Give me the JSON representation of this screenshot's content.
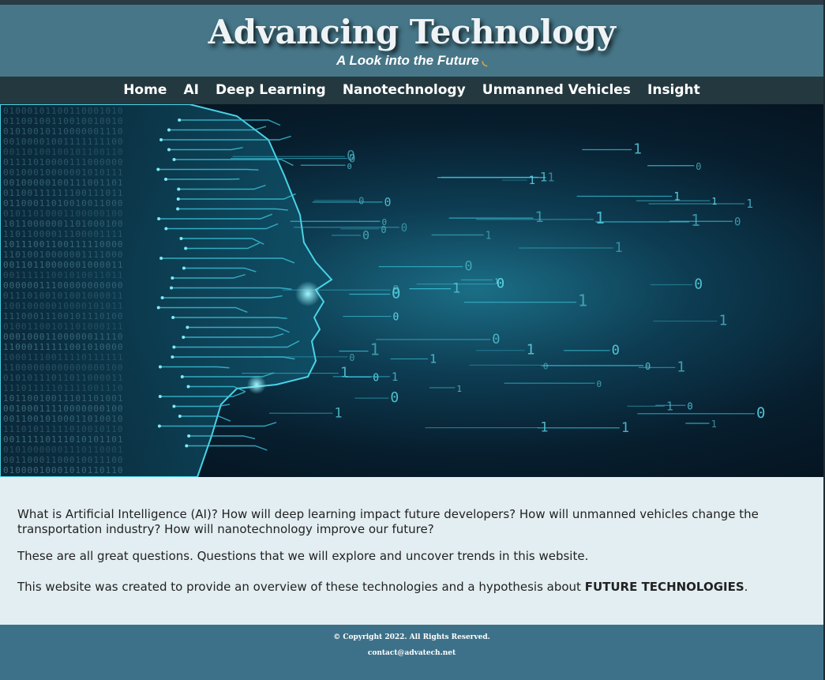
{
  "header": {
    "title": "Advancing Technology",
    "tagline": "A Look into the Future",
    "tagline_icon": "spinner-icon"
  },
  "nav": {
    "items": [
      {
        "label": "Home"
      },
      {
        "label": "AI"
      },
      {
        "label": "Deep Learning"
      },
      {
        "label": "Nanotechnology"
      },
      {
        "label": "Unmanned Vehicles"
      },
      {
        "label": "Insight"
      }
    ]
  },
  "hero": {
    "image": "ai-head-binary-image"
  },
  "content": {
    "p1": "What is Artificial Intelligence (AI)? How will deep learning impact future developers? How will unmanned vehicles change the transportation industry? How will nanotechnology improve our future?",
    "p2": "These are all great questions. Questions that we will explore and uncover trends in this website.",
    "p3_prefix": "This website was created to provide an overview of these technologies and a hypothesis about ",
    "p3_strong": "FUTURE TECHNOLOGIES",
    "p3_suffix": "."
  },
  "footer": {
    "copyright": "© Copyright 2022. All Rights Reserved.",
    "email": "contact@advatech.net"
  },
  "colors": {
    "header_bg": "#467688",
    "nav_bg": "#24383f",
    "content_bg": "#e3eef2",
    "footer_bg": "#3d7189",
    "accent": "#e8a23a",
    "hero_cyan": "#36c4d8"
  }
}
